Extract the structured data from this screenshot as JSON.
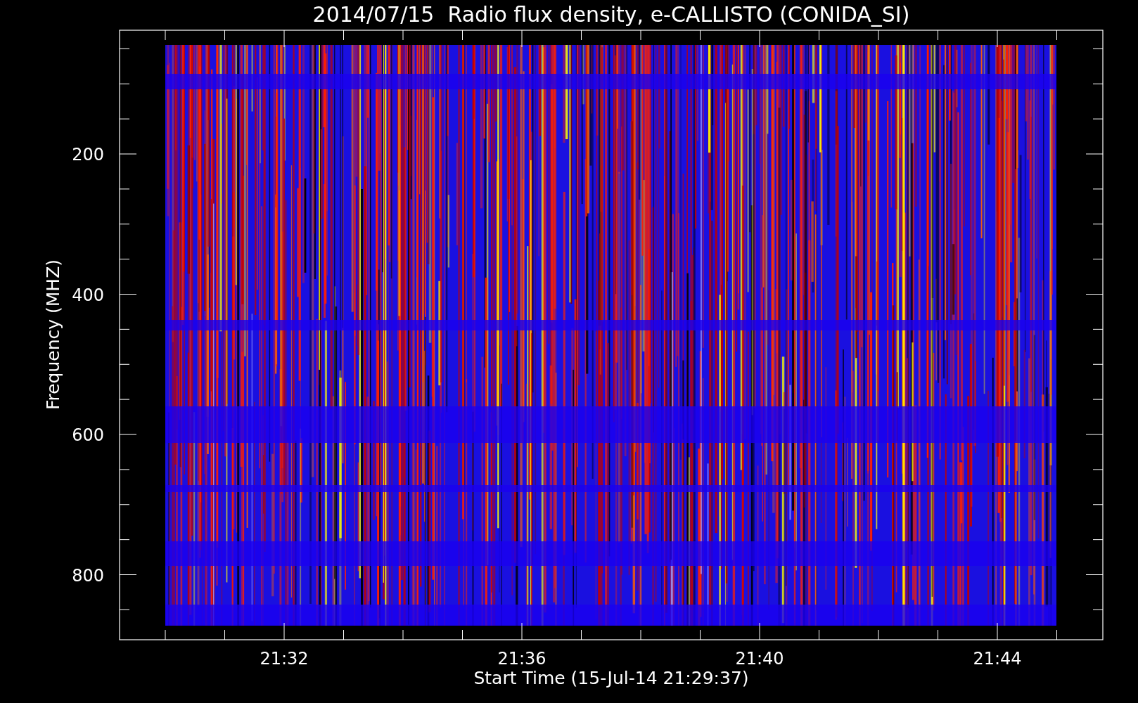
{
  "title": "2014/07/15  Radio flux density, e-CALLISTO (CONIDA_SI)",
  "xlabel": "Start Time (15-Jul-14 21:29:37)",
  "ylabel": "Frequency (MHZ)",
  "xticks": [
    "21:32",
    "21:36",
    "21:40",
    "21:44"
  ],
  "yticks": [
    "200",
    "400",
    "600",
    "800"
  ]
}
